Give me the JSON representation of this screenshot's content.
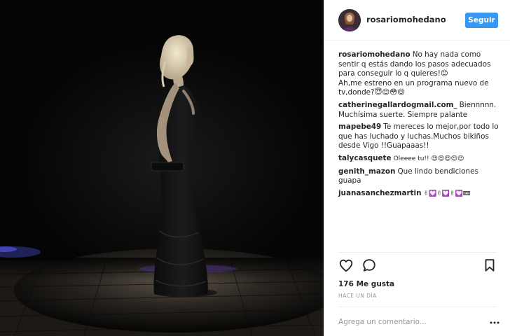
{
  "post": {
    "username": "rosariomohedano",
    "follow_label": "Seguir",
    "caption": {
      "author": "rosariomohedano",
      "lines": [
        "No hay nada como sentir q estás dando los pasos adecuados para conseguir lo q quieres!😊",
        "Ah,me estreno en un programa nuevo de tv,donde?😇😌😳😌"
      ]
    },
    "comments": [
      {
        "author": "catherinegallardogmail.com_",
        "text": "Biennnnn. Muchísima suerte. Siempre palante"
      },
      {
        "author": "mapebe49",
        "text": "Te mereces lo mejor,por todo lo que has luchado y luchas.Muchos bikiños desde Vigo !!Guapaaas!!"
      },
      {
        "author": "talycasquete",
        "text": "Oleeee tu!! 😍😍😍😍😍"
      },
      {
        "author": "genith_mazon",
        "text": "Que lindo bendiciones guapa"
      },
      {
        "author": "juanasanchezmartin",
        "text": "✌💟✌💟✌💟📼"
      }
    ],
    "likes": "176 Me gusta",
    "time": "HACE UN DÍA",
    "add_comment_placeholder": "Agrega un comentario...",
    "icons": {
      "like": "heart-icon",
      "comment": "comment-bubble-icon",
      "save": "bookmark-icon",
      "more": "more-options-icon"
    },
    "colors": {
      "follow_button": "#3897f0",
      "text": "#262626",
      "muted": "#999999",
      "divider": "#efefef"
    }
  }
}
